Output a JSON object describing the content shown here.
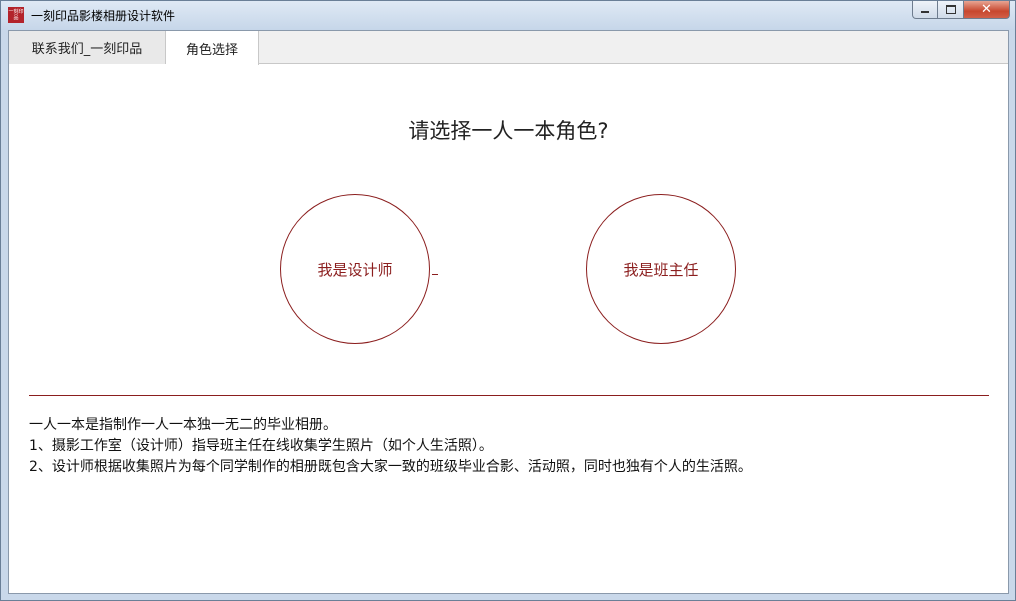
{
  "window": {
    "title": "一刻印品影楼相册设计软件",
    "icon_text": "一刻印品",
    "controls": {
      "minimize": "▭",
      "maximize": "□",
      "close": "✕"
    }
  },
  "tabs": [
    {
      "label": "联系我们_一刻印品",
      "active": false
    },
    {
      "label": "角色选择",
      "active": true
    }
  ],
  "main": {
    "question": "请选择一人一本角色?",
    "roles": [
      {
        "label": "我是设计师"
      },
      {
        "label": "我是班主任"
      }
    ],
    "description": [
      "一人一本是指制作一人一本独一无二的毕业相册。",
      "1、摄影工作室（设计师）指导班主任在线收集学生照片（如个人生活照）。",
      "2、设计师根据收集照片为每个同学制作的相册既包含大家一致的班级毕业合影、活动照，同时也独有个人的生活照。"
    ]
  },
  "colors": {
    "accent": "#8b1e1e",
    "titlebar": "#c6d6e9",
    "tab_inactive": "#e9e9e9",
    "tab_active": "#ffffff"
  }
}
